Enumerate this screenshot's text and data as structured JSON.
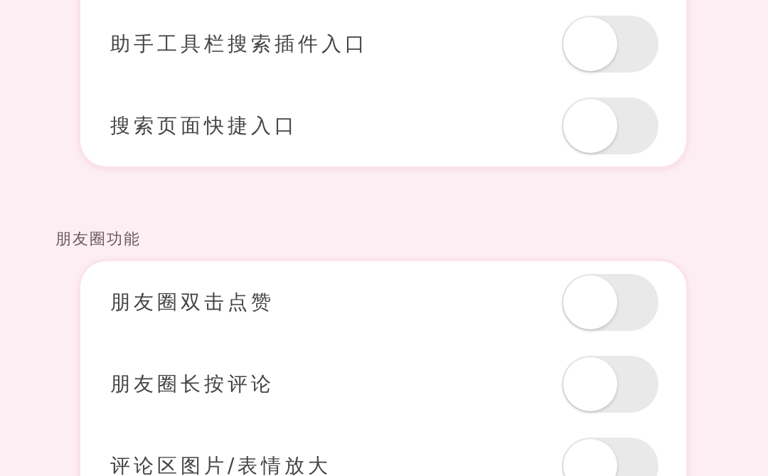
{
  "sections": [
    {
      "items": [
        {
          "label": "助手工具栏搜索插件入口",
          "on": false
        },
        {
          "label": "搜索页面快捷入口",
          "on": false
        }
      ]
    },
    {
      "title": "朋友圈功能",
      "items": [
        {
          "label": "朋友圈双击点赞",
          "on": false
        },
        {
          "label": "朋友圈长按评论",
          "on": false
        },
        {
          "label": "评论区图片/表情放大",
          "on": false
        }
      ]
    }
  ]
}
